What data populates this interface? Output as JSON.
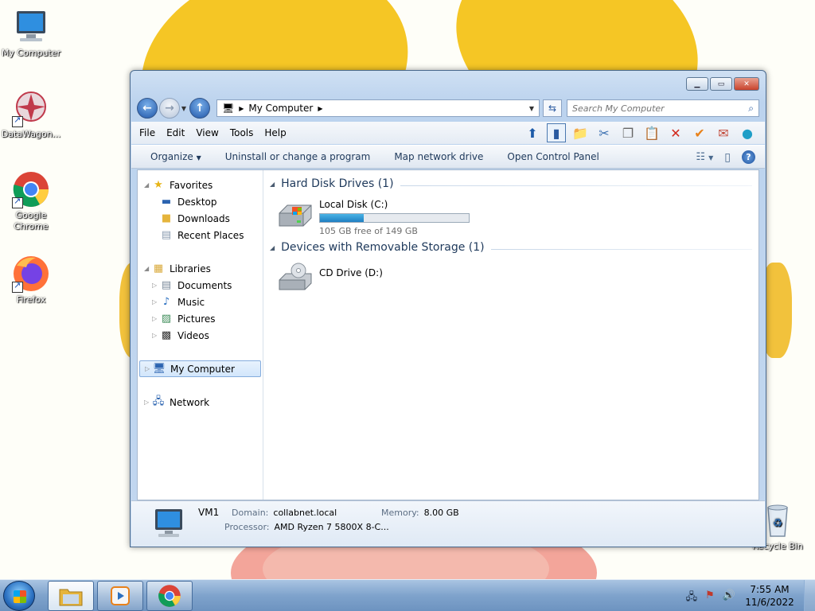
{
  "desktop": {
    "icons": [
      {
        "label": "My Computer"
      },
      {
        "label": "DataWagon..."
      },
      {
        "label": "Google Chrome"
      },
      {
        "label": "Firefox"
      },
      {
        "label": "Recycle Bin"
      }
    ]
  },
  "window": {
    "address": {
      "crumb": "My Computer"
    },
    "search": {
      "placeholder": "Search My Computer"
    },
    "menu": [
      "File",
      "Edit",
      "View",
      "Tools",
      "Help"
    ],
    "commands": [
      "Organize",
      "Uninstall or change a program",
      "Map network drive",
      "Open Control Panel"
    ],
    "nav": {
      "favorites": "Favorites",
      "desktop": "Desktop",
      "downloads": "Downloads",
      "recent": "Recent Places",
      "libraries": "Libraries",
      "documents": "Documents",
      "music": "Music",
      "pictures": "Pictures",
      "videos": "Videos",
      "computer": "My Computer",
      "network": "Network"
    },
    "groups": {
      "hdd": "Hard Disk Drives (1)",
      "removable": "Devices with Removable Storage (1)"
    },
    "drives": {
      "c": {
        "name": "Local Disk (C:)",
        "free": "105 GB free of 149 GB",
        "used_fraction": 0.295
      },
      "d": {
        "name": "CD Drive (D:)"
      }
    },
    "details": {
      "name": "VM1",
      "domain_label": "Domain:",
      "domain": "collabnet.local",
      "memory_label": "Memory:",
      "memory": "8.00 GB",
      "processor_label": "Processor:",
      "processor": "AMD Ryzen 7 5800X 8-C..."
    }
  },
  "taskbar": {
    "time": "7:55 AM",
    "date": "11/6/2022"
  },
  "colors": {
    "accent": "#1e395b",
    "bar_fill": "#26a0da"
  }
}
